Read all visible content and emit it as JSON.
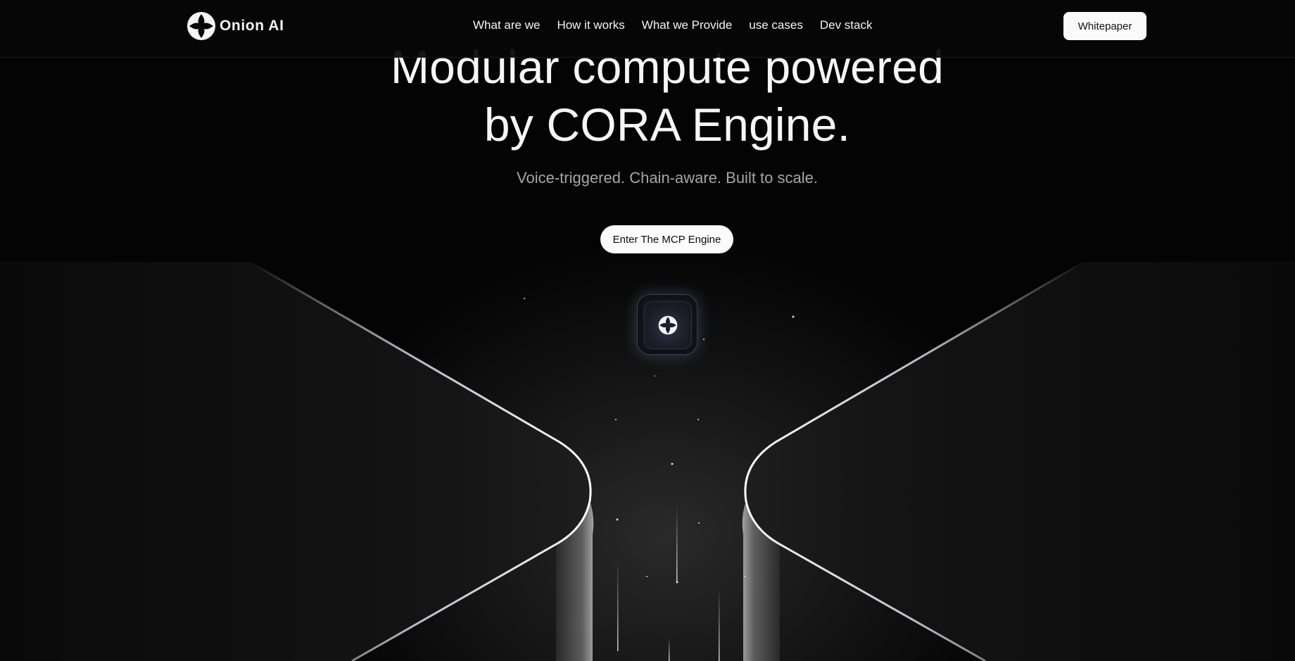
{
  "brand": {
    "name": "Onion AI",
    "logo_icon": "onion-logo-icon"
  },
  "nav": {
    "links": [
      "What are we",
      "How it works",
      "What we Provide",
      "use cases",
      "Dev stack"
    ],
    "cta_label": "Whitepaper"
  },
  "hero": {
    "title_line1": "Modular compute powered",
    "title_line2": "by CORA Engine.",
    "subtitle": "Voice-triggered. Chain-aware. Built to scale.",
    "cta_label": "Enter The MCP Engine",
    "core_icon": "onion-logo-icon"
  },
  "colors": {
    "background": "#040404",
    "text_primary": "#f6f6f6",
    "text_muted": "#a6a6a6",
    "button_bg": "#fafafa"
  }
}
